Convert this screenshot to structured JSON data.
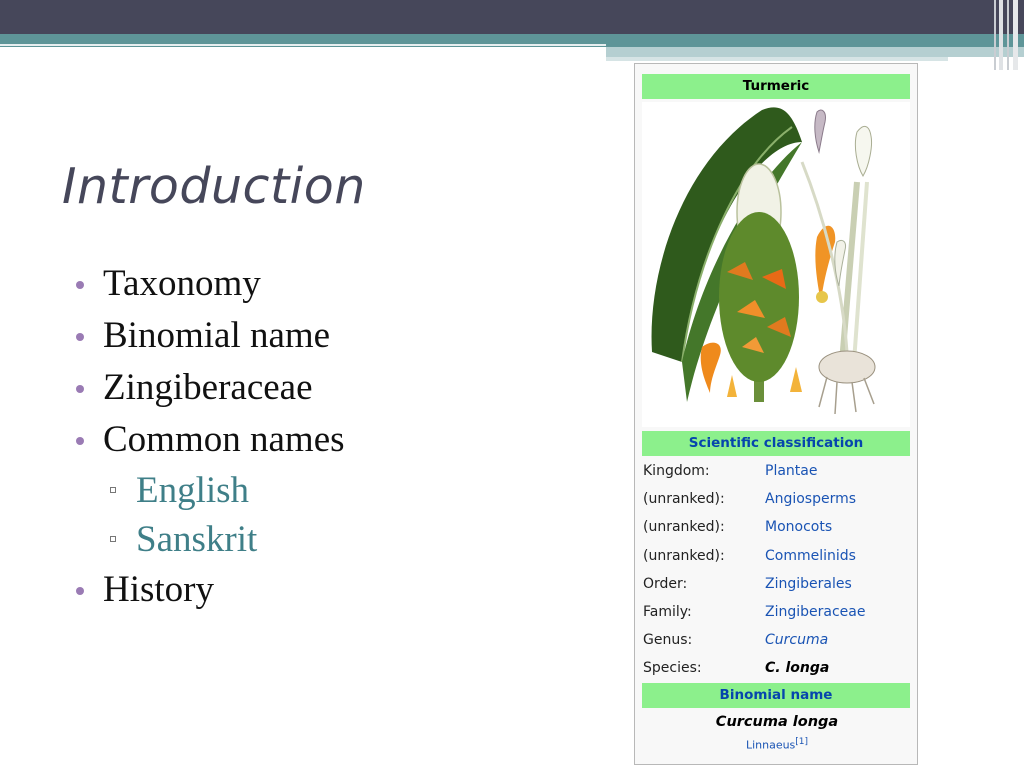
{
  "slide": {
    "title": "Introduction",
    "bullets": [
      {
        "text": "Taxonomy",
        "level": 1
      },
      {
        "text": "Binomial name",
        "level": 1
      },
      {
        "text": "Zingiberaceae",
        "level": 1
      },
      {
        "text": "Common names",
        "level": 1
      },
      {
        "text": "English",
        "level": 2
      },
      {
        "text": "Sanskrit",
        "level": 2
      },
      {
        "text": "History",
        "level": 1
      }
    ]
  },
  "infobox": {
    "title": "Turmeric",
    "illustration": "turmeric-botanical-illustration",
    "classification_header": "Scientific classification",
    "rows": [
      {
        "key": "Kingdom:",
        "value": "Plantae"
      },
      {
        "key": "(unranked):",
        "value": "Angiosperms"
      },
      {
        "key": "(unranked):",
        "value": "Monocots"
      },
      {
        "key": "(unranked):",
        "value": "Commelinids"
      },
      {
        "key": "Order:",
        "value": "Zingiberales"
      },
      {
        "key": "Family:",
        "value": "Zingiberaceae"
      },
      {
        "key": "Genus:",
        "value": "Curcuma"
      },
      {
        "key": "Species:",
        "value": "C. longa"
      }
    ],
    "binomial_header": "Binomial name",
    "binomial_name": "Curcuma longa",
    "authority": "Linnaeus",
    "authority_ref": "[1]"
  },
  "colors": {
    "header_dark": "#46475a",
    "header_teal": "#5e9598",
    "bullet_dot": "#9a7bb4",
    "sub_bullet_text": "#3f7f88",
    "infobox_header": "#8cf08c",
    "link_blue": "#1a54b4"
  }
}
